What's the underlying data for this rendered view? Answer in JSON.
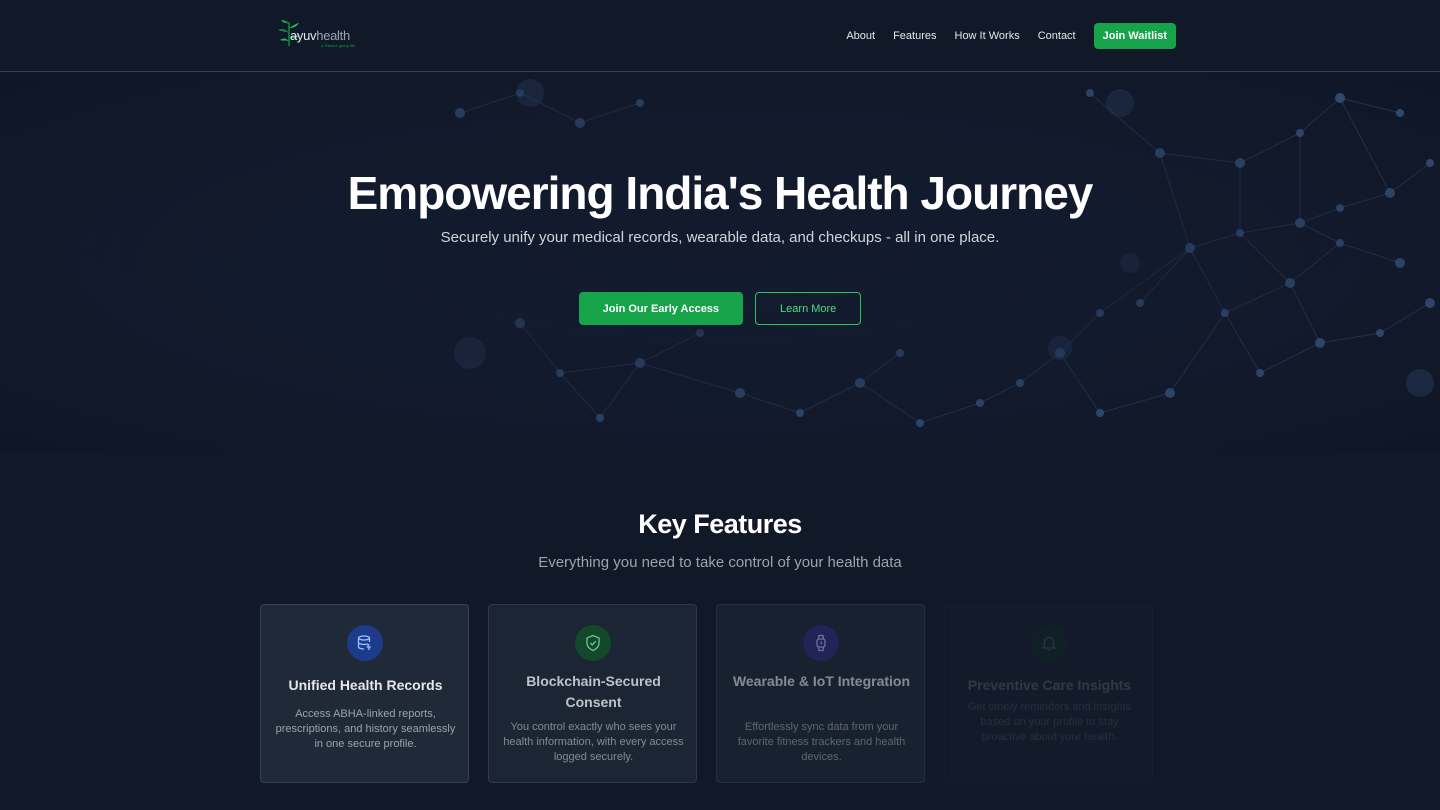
{
  "header": {
    "logo": {
      "brand_a": "ayuv",
      "brand_b": "health",
      "tagline": "a Trikon4 group life"
    },
    "nav": [
      {
        "label": "About"
      },
      {
        "label": "Features"
      },
      {
        "label": "How It Works"
      },
      {
        "label": "Contact"
      }
    ],
    "waitlist_label": "Join Waitlist"
  },
  "hero": {
    "title": "Empowering India's Health Journey",
    "subtitle": "Securely unify your medical records, wearable data, and checkups - all in one place.",
    "primary_cta": "Join Our Early Access",
    "secondary_cta": "Learn More"
  },
  "features": {
    "title": "Key Features",
    "subtitle": "Everything you need to take control of your health data",
    "cards": [
      {
        "icon": "database-icon",
        "title": "Unified Health Records",
        "desc": "Access ABHA-linked reports, prescriptions, and history seamlessly in one secure profile.",
        "accent": "#1e3a8a"
      },
      {
        "icon": "shield-check-icon",
        "title": "Blockchain-Secured Consent",
        "desc": "You control exactly who sees your health information, with every access logged securely.",
        "accent": "#14532d"
      },
      {
        "icon": "watch-icon",
        "title": "Wearable & IoT Integration",
        "desc": "Effortlessly sync data from your favorite fitness trackers and health devices.",
        "accent": "#312e81"
      },
      {
        "icon": "bell-icon",
        "title": "Preventive Care Insights",
        "desc": "Get timely reminders and insights based on your profile to stay proactive about your health.",
        "accent": "#14532d"
      }
    ]
  },
  "colors": {
    "background": "#111827",
    "brand_green": "#16a34a",
    "card": "#1f2937",
    "outline_green": "#4ade80"
  }
}
